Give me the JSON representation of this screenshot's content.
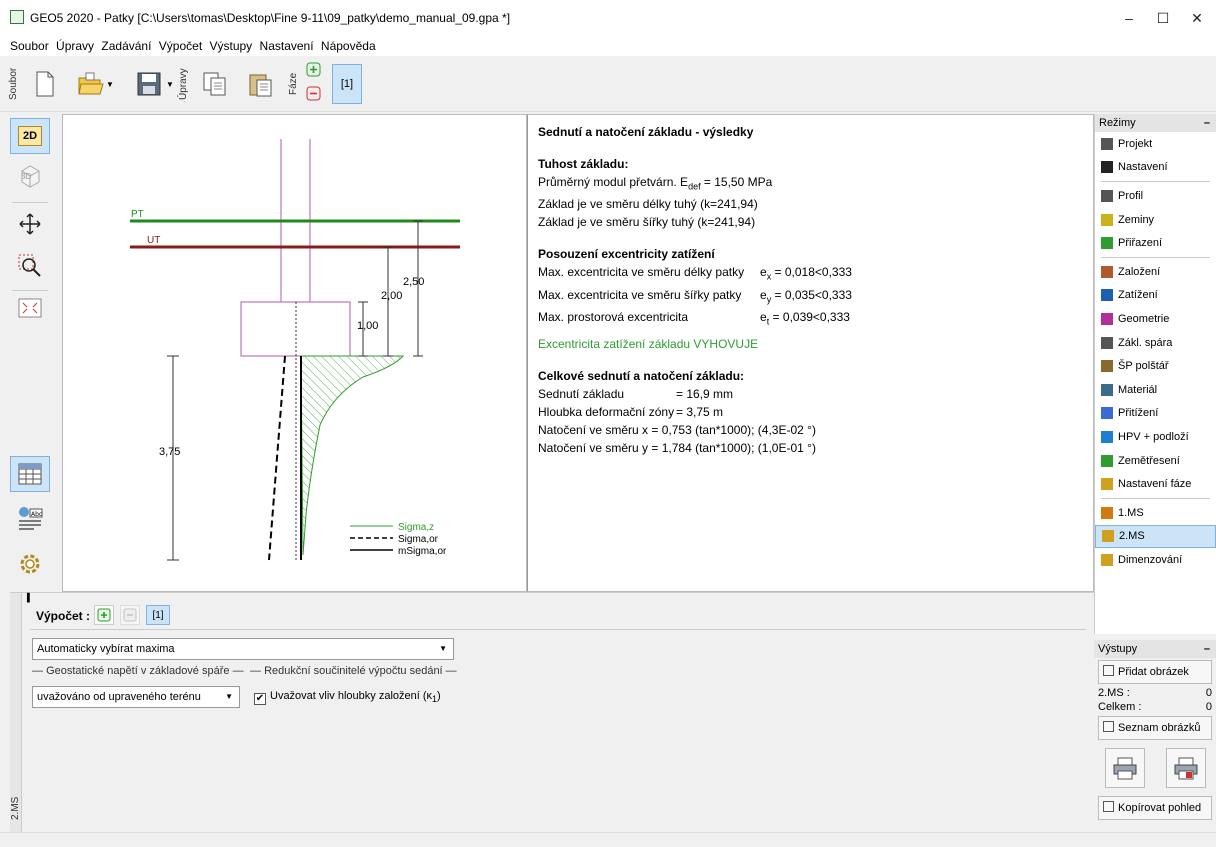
{
  "window": {
    "title": "GEO5 2020 - Patky [C:\\Users\\tomas\\Desktop\\Fine 9-11\\09_patky\\demo_manual_09.gpa *]",
    "minimize": "–",
    "maximize": "☐",
    "close": "✕"
  },
  "menu": [
    "Soubor",
    "Úpravy",
    "Zadávání",
    "Výpočet",
    "Výstupy",
    "Nastavení",
    "Nápověda"
  ],
  "toolbar": {
    "soubor_label": "Soubor",
    "upravy_label": "Úpravy",
    "faze_label": "Fáze",
    "stage_label": "[1]"
  },
  "left_tools": {
    "btn_2d": "2D",
    "btn_3d": "3D"
  },
  "drawing": {
    "pt_label": "PT",
    "ut_label": "UT",
    "dim_250": "2,50",
    "dim_200": "2,00",
    "dim_100": "1,00",
    "dim_375": "3,75",
    "legend": [
      {
        "label": "Sigma,z",
        "color": "#2e9d2e"
      },
      {
        "label": "Sigma,or",
        "color": "#000000"
      },
      {
        "label": "mSigma,or",
        "color": "#000000"
      }
    ]
  },
  "results": {
    "heading": "Sednutí a natočení základu - výsledky",
    "stiffness_title": "Tuhost základu:",
    "modulus_prefix": "Průměrný modul přetvárn. E",
    "modulus_sub": "def",
    "modulus_value": " = 15,50 MPa",
    "stiff_length": "Základ je ve směru délky tuhý (k=241,94)",
    "stiff_width": "Základ je ve směru šířky tuhý (k=241,94)",
    "ecc_title": "Posouzení excentricity zatížení",
    "ecc_x_label": "Max. excentricita ve směru délky patky",
    "ecc_x_sym": "e",
    "ecc_x_sub": "x",
    "ecc_x_value": "= 0,018<0,333",
    "ecc_y_label": "Max. excentricita ve směru šířky patky",
    "ecc_y_sym": "e",
    "ecc_y_sub": "y",
    "ecc_y_value": "= 0,035<0,333",
    "ecc_t_label": "Max. prostorová excentricita",
    "ecc_t_sym": "e",
    "ecc_t_sub": "t",
    "ecc_t_value": "= 0,039<0,333",
    "ecc_ok": "Excentricita zatížení základu VYHOVUJE",
    "settle_title": "Celkové sednutí a natočení základu:",
    "settle_label": "Sednutí základu",
    "settle_value": "=  16,9  mm",
    "depth_label": "Hloubka deformační zóny",
    "depth_value": "=  3,75  m",
    "rot_x": "Natočení ve směru x = 0,753 (tan*1000); (4,3E-02 °)",
    "rot_y": "Natočení ve směru y = 1,784 (tan*1000); (1,0E-01 °)"
  },
  "modes": {
    "header": "Režimy",
    "items": [
      {
        "label": "Projekt",
        "icon": "document-icon"
      },
      {
        "label": "Nastavení",
        "icon": "gear-icon"
      },
      {
        "label": "Profil",
        "icon": "profile-icon"
      },
      {
        "label": "Zeminy",
        "icon": "soil-icon"
      },
      {
        "label": "Přiřazení",
        "icon": "assign-icon"
      },
      {
        "label": "Založení",
        "icon": "foundation-icon"
      },
      {
        "label": "Zatížení",
        "icon": "load-icon"
      },
      {
        "label": "Geometrie",
        "icon": "geometry-icon"
      },
      {
        "label": "Zákl. spára",
        "icon": "footing-bottom-icon"
      },
      {
        "label": "ŠP polštář",
        "icon": "cushion-icon"
      },
      {
        "label": "Materiál",
        "icon": "material-icon"
      },
      {
        "label": "Přitížení",
        "icon": "surcharge-icon"
      },
      {
        "label": "HPV + podloží",
        "icon": "water-table-icon"
      },
      {
        "label": "Zemětřesení",
        "icon": "earthquake-icon"
      },
      {
        "label": "Nastavení fáze",
        "icon": "stage-settings-icon"
      },
      {
        "label": "1.MS",
        "icon": "ms1-icon"
      },
      {
        "label": "2.MS",
        "icon": "ms2-icon"
      },
      {
        "label": "Dimenzování",
        "icon": "dimensioning-icon"
      }
    ]
  },
  "outputs": {
    "header": "Výstupy",
    "add_picture": "Přidat obrázek",
    "ms2_label": "2.MS :",
    "ms2_count": "0",
    "total_label": "Celkem :",
    "total_count": "0",
    "list_pictures": "Seznam obrázků",
    "copy_view": "Kopírovat pohled"
  },
  "bottom": {
    "calc_label": "Výpočet :",
    "stage_label": "[1]",
    "max_select": "Automaticky vybírat maxima",
    "geo_group": "Geostatické napětí v základové spáře",
    "red_group": "Redukční součinitelé výpočtu sedání",
    "geo_select": "uvažováno od upraveného terénu",
    "check_prefix": "Uvažovat vliv hloubky založení (κ",
    "check_sub": "1",
    "check_suffix": ")",
    "side_label": "2.MS"
  }
}
